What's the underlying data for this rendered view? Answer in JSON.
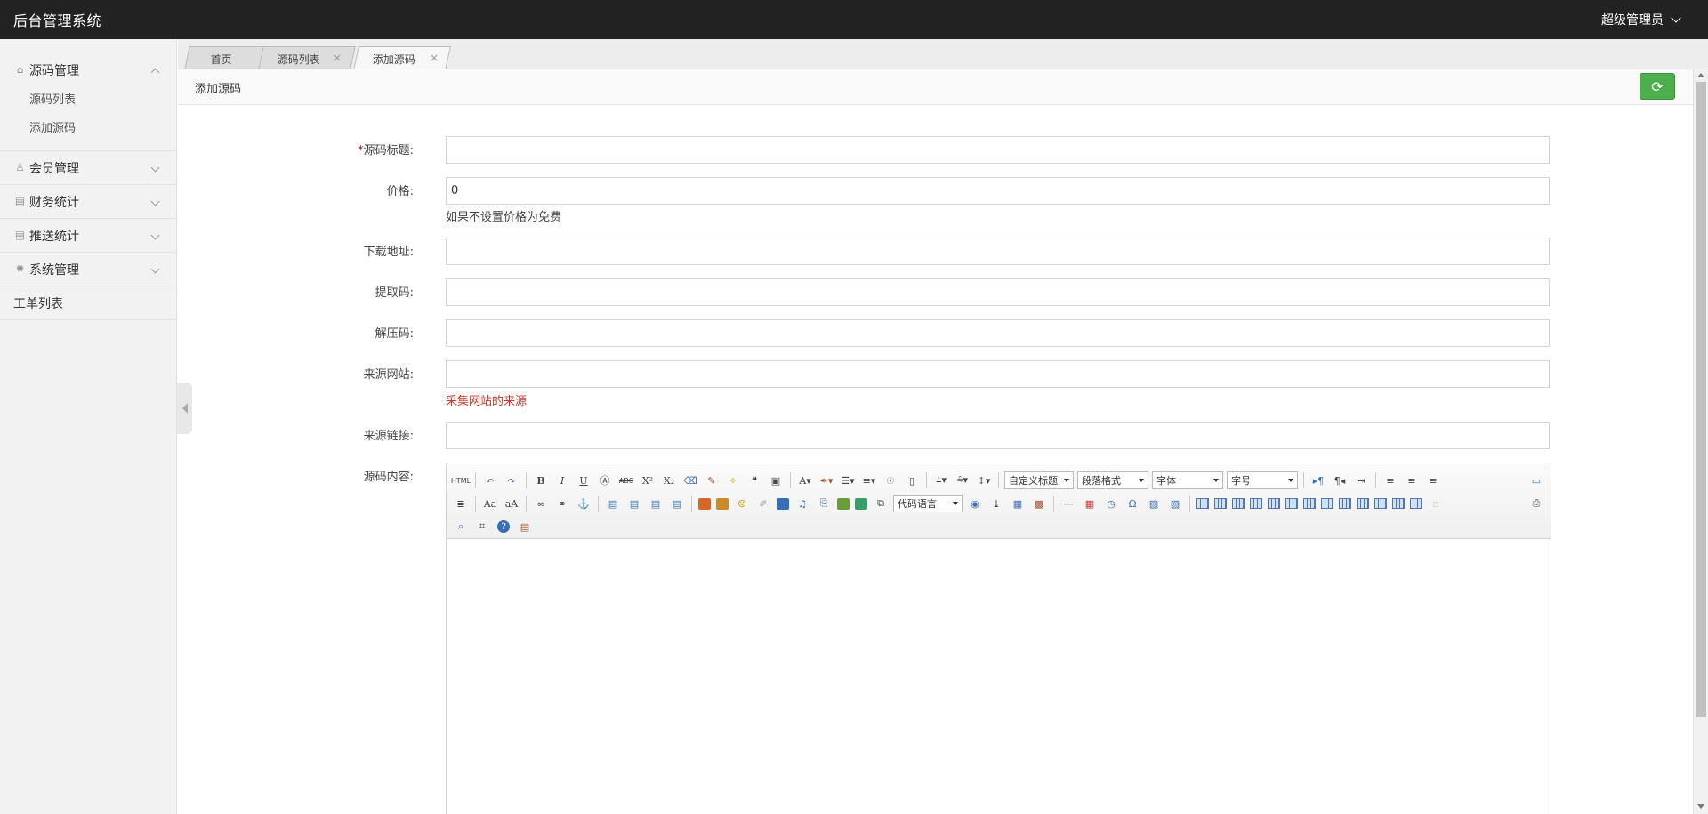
{
  "app": {
    "title": "后台管理系统",
    "user": "超级管理员"
  },
  "sidebar": {
    "groups": [
      {
        "label": "源码管理",
        "items": [
          "源码列表",
          "添加源码"
        ]
      },
      {
        "label": "会员管理"
      },
      {
        "label": "财务统计"
      },
      {
        "label": "推送统计"
      },
      {
        "label": "系统管理"
      },
      {
        "label": "工单列表"
      }
    ]
  },
  "tabs": [
    {
      "label": "首页"
    },
    {
      "label": "源码列表"
    },
    {
      "label": "添加源码"
    }
  ],
  "page": {
    "title": "添加源码"
  },
  "form": {
    "title_label": "源码标题:",
    "title_required": "*",
    "price_label": "价格:",
    "price_value": "0",
    "price_help": "如果不设置价格为免费",
    "download_label": "下载地址:",
    "extract_label": "提取码:",
    "unzip_label": "解压码:",
    "source_site_label": "来源网站:",
    "source_site_help": "采集网站的来源",
    "source_link_label": "来源链接:",
    "content_label": "源码内容:"
  },
  "editor": {
    "html_btn": "HTML",
    "custom_title": "自定义标题",
    "paragraph": "段落格式",
    "font_family": "字体",
    "font_size": "字号",
    "code_lang": "代码语言"
  }
}
